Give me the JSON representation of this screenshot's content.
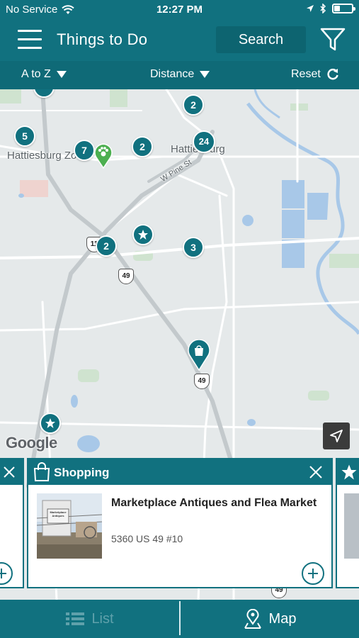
{
  "status_bar": {
    "carrier": "No Service",
    "time": "12:27 PM"
  },
  "header": {
    "title": "Things to Do",
    "search_label": "Search"
  },
  "sort_bar": {
    "atoz_label": "A to Z",
    "distance_label": "Distance",
    "reset_label": "Reset"
  },
  "map": {
    "city_labels": [
      "Hattiesburg Zoo",
      "Hattiesburg"
    ],
    "street_label": "W Pine St",
    "route_shields": [
      "11",
      "49",
      "49",
      "49"
    ],
    "cluster_counts": [
      "2",
      "5",
      "7",
      "2",
      "24",
      "2",
      "3"
    ],
    "attribution": "Google"
  },
  "card": {
    "category": "Shopping",
    "name": "Marketplace Antiques and Flea Market",
    "address": "5360 US 49 #10",
    "thumb_sign": "Marketplace Antiques"
  },
  "tabs": {
    "list_label": "List",
    "map_label": "Map"
  },
  "colors": {
    "brand": "#11717f",
    "marker_green": "#4caf50",
    "water": "#a8c8e8"
  }
}
